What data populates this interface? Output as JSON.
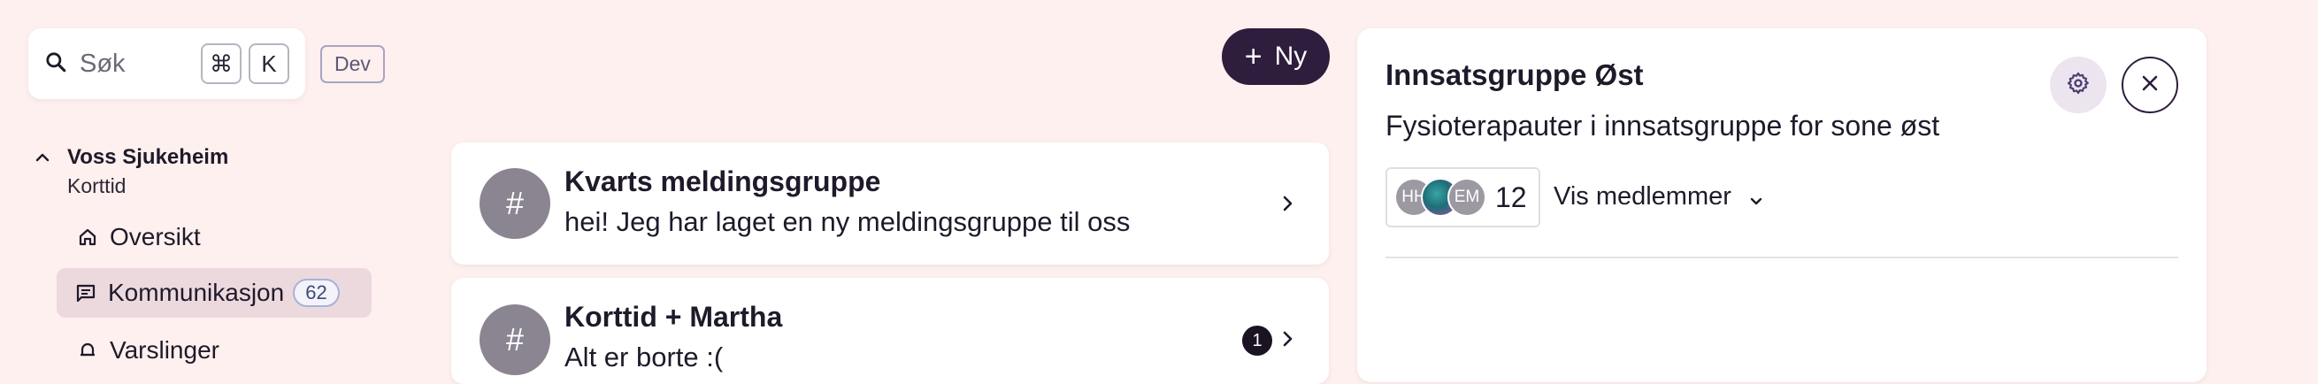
{
  "search": {
    "placeholder": "Søk",
    "kbd_cmd": "⌘",
    "kbd_key": "K"
  },
  "env_badge": "Dev",
  "sidebar": {
    "org_name": "Voss Sjukeheim",
    "org_sub": "Korttid",
    "items": [
      {
        "label": "Oversikt",
        "icon": "home-icon"
      },
      {
        "label": "Kommunikasjon",
        "icon": "message-icon",
        "count": "62",
        "active": true
      },
      {
        "label": "Varslinger",
        "icon": "bell-icon"
      }
    ]
  },
  "new_button": {
    "label": "Ny"
  },
  "chats": [
    {
      "icon": "#",
      "title": "Kvarts meldingsgruppe",
      "message": "hei! Jeg har laget en ny meldingsgruppe til oss"
    },
    {
      "icon": "#",
      "title": "Korttid + Martha",
      "message": "Alt er borte :(",
      "unread": "1"
    }
  ],
  "panel": {
    "title": "Innsatsgruppe Øst",
    "description": "Fysioterapauter i innsatsgruppe for sone øst",
    "avatars": [
      "HH",
      "",
      "EM"
    ],
    "member_count": "12",
    "show_members": "Vis medlemmer"
  },
  "colors": {
    "accent": "#2e1d3c",
    "background": "#fdf0ee",
    "active_nav": "#ecd9de"
  }
}
